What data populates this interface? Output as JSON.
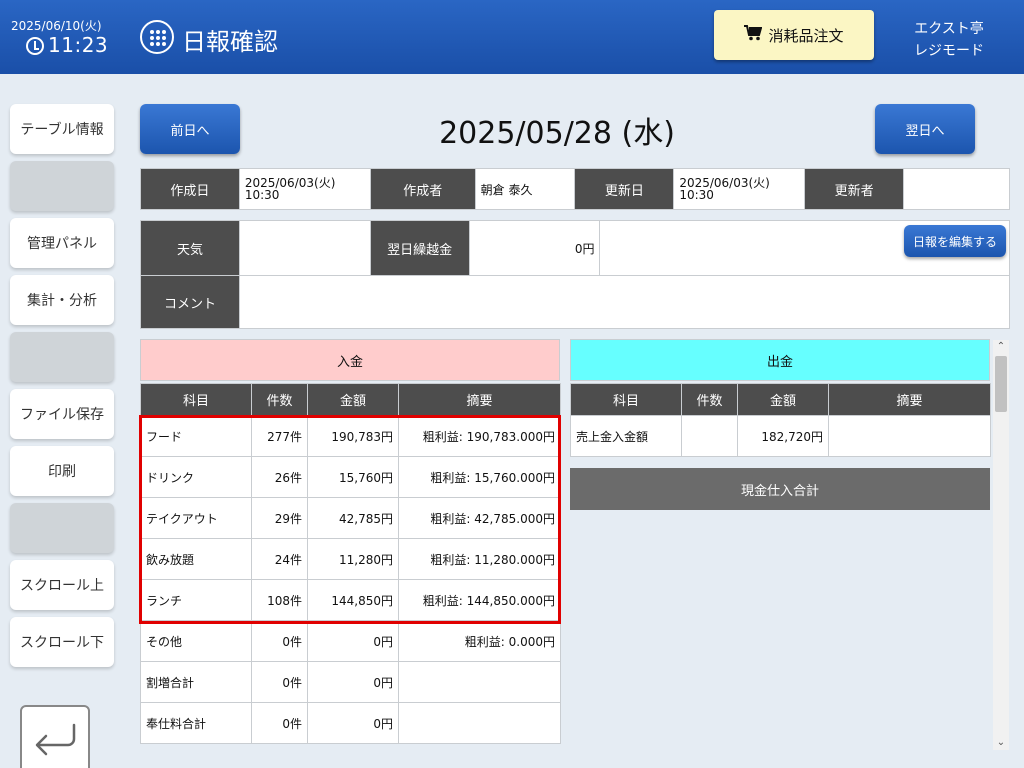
{
  "header": {
    "date": "2025/06/10(火)",
    "time": "11:23",
    "title": "日報確認",
    "order_button": "消耗品注文",
    "shop_name": "エクスト亭",
    "mode": "レジモード"
  },
  "sidebar": {
    "items": [
      {
        "label": "テーブル情報"
      },
      {
        "label": ""
      },
      {
        "label": "管理パネル"
      },
      {
        "label": "集計・分析"
      },
      {
        "label": ""
      },
      {
        "label": "ファイル保存"
      },
      {
        "label": "印刷"
      },
      {
        "label": ""
      },
      {
        "label": "スクロール上"
      },
      {
        "label": "スクロール下"
      }
    ]
  },
  "nav": {
    "prev": "前日へ",
    "next": "翌日へ",
    "date": "2025/05/28 (水)"
  },
  "meta": {
    "created_label": "作成日",
    "created_value": "2025/06/03(火) 10:30",
    "author_label": "作成者",
    "author_value": "朝倉 泰久",
    "updated_label": "更新日",
    "updated_value": "2025/06/03(火) 10:30",
    "updater_label": "更新者",
    "updater_value": ""
  },
  "daily": {
    "weather_label": "天気",
    "weather_value": "",
    "carry_label": "翌日繰越金",
    "carry_value": "0円",
    "comment_label": "コメント",
    "comment_value": "",
    "edit_button": "日報を編集する"
  },
  "income": {
    "title": "入金",
    "columns": [
      "科目",
      "件数",
      "金額",
      "摘要"
    ],
    "rows": [
      {
        "item": "フード",
        "count": "277件",
        "amount": "190,783円",
        "note": "粗利益: 190,783.000円"
      },
      {
        "item": "ドリンク",
        "count": "26件",
        "amount": "15,760円",
        "note": "粗利益: 15,760.000円"
      },
      {
        "item": "テイクアウト",
        "count": "29件",
        "amount": "42,785円",
        "note": "粗利益: 42,785.000円"
      },
      {
        "item": "飲み放題",
        "count": "24件",
        "amount": "11,280円",
        "note": "粗利益: 11,280.000円"
      },
      {
        "item": "ランチ",
        "count": "108件",
        "amount": "144,850円",
        "note": "粗利益: 144,850.000円"
      },
      {
        "item": "その他",
        "count": "0件",
        "amount": "0円",
        "note": "粗利益: 0.000円"
      },
      {
        "item": "割増合計",
        "count": "0件",
        "amount": "0円",
        "note": ""
      },
      {
        "item": "奉仕料合計",
        "count": "0件",
        "amount": "0円",
        "note": ""
      }
    ]
  },
  "expense": {
    "title": "出金",
    "columns": [
      "科目",
      "件数",
      "金額",
      "摘要"
    ],
    "rows": [
      {
        "item": "売上金入金額",
        "count": "",
        "amount": "182,720円",
        "note": ""
      }
    ],
    "cash_purchase_total": "現金仕入合計"
  },
  "colors": {
    "header_bg": "#1f57b3",
    "income_head": "#ffcccc",
    "expense_head": "#66ffff",
    "highlight": "#e00000"
  }
}
